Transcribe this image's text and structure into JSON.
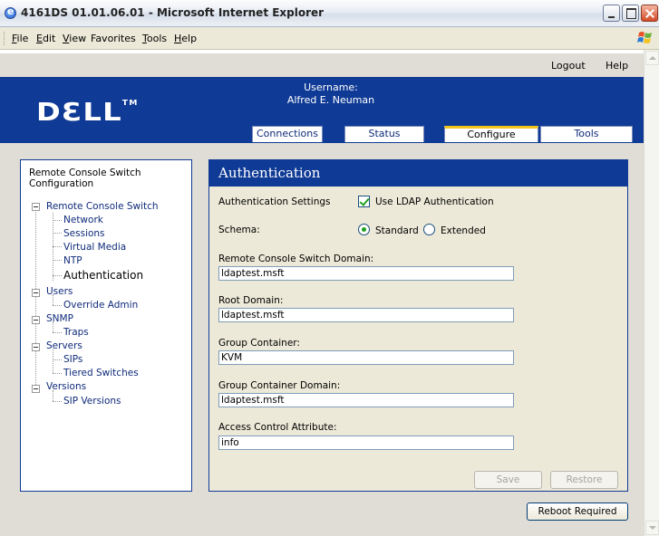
{
  "window": {
    "title": "4161DS 01.01.06.01 - Microsoft Internet Explorer"
  },
  "menubar": {
    "items": [
      {
        "first": "F",
        "rest": "ile"
      },
      {
        "first": "E",
        "rest": "dit"
      },
      {
        "first": "V",
        "rest": "iew"
      },
      {
        "first": "F",
        "rest": "a",
        "pre": "",
        "label": "Favorites"
      },
      {
        "first": "T",
        "rest": "ools"
      },
      {
        "first": "H",
        "rest": "elp"
      }
    ]
  },
  "header": {
    "logout": "Logout",
    "help": "Help",
    "logo_text": "DƐLL",
    "logo_tm": "TM",
    "username_label": "Username:",
    "username": "Alfred E. Neuman"
  },
  "tabs": [
    {
      "label": "Connections"
    },
    {
      "label": "Status"
    },
    {
      "label": "Configure",
      "active": true
    },
    {
      "label": "Tools"
    }
  ],
  "tree": {
    "title": "Remote Console Switch Configuration",
    "nodes": [
      {
        "label": "Remote Console Switch"
      },
      {
        "label": "Network"
      },
      {
        "label": "Sessions"
      },
      {
        "label": "Virtual Media"
      },
      {
        "label": "NTP"
      },
      {
        "label": "Authentication",
        "selected": true
      },
      {
        "label": "Users"
      },
      {
        "label": "Override Admin"
      },
      {
        "label": "SNMP"
      },
      {
        "label": "Traps"
      },
      {
        "label": "Servers"
      },
      {
        "label": "SIPs"
      },
      {
        "label": "Tiered Switches"
      },
      {
        "label": "Versions"
      },
      {
        "label": "SIP Versions"
      }
    ]
  },
  "form": {
    "title": "Authentication",
    "auth_settings_label": "Authentication Settings",
    "use_ldap_label": "Use LDAP Authentication",
    "use_ldap_checked": true,
    "schema_label": "Schema:",
    "schema_standard": "Standard",
    "schema_extended": "Extended",
    "schema_selected": "Standard",
    "rcs_domain_label": "Remote Console Switch Domain:",
    "rcs_domain_value": "ldaptest.msft",
    "root_domain_label": "Root Domain:",
    "root_domain_value": "ldaptest.msft",
    "group_container_label": "Group Container:",
    "group_container_value": "KVM",
    "group_container_domain_label": "Group Container Domain:",
    "group_container_domain_value": "ldaptest.msft",
    "access_control_label": "Access Control Attribute:",
    "access_control_value": "info",
    "save_label": "Save",
    "restore_label": "Restore",
    "reboot_label": "Reboot Required"
  }
}
